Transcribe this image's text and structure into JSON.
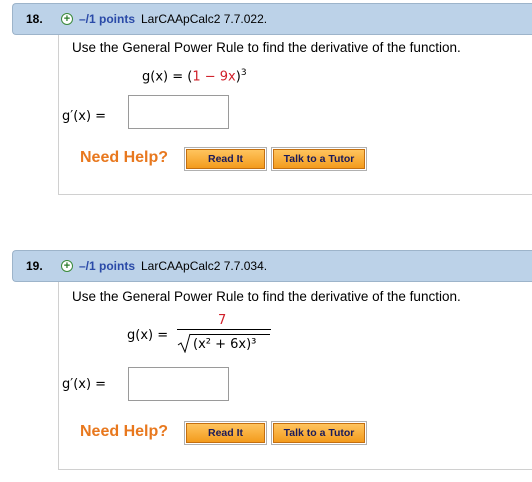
{
  "questions": [
    {
      "number": "18.",
      "points": "–/1 points",
      "id": "LarCAApCalc2 7.7.022.",
      "prompt": "Use the General Power Rule to find the derivative of the function.",
      "func_lhs": "g(x) = ",
      "func_open": "(",
      "func_red": "1 − 9x",
      "func_close": ")",
      "func_exp": "3",
      "answer_label": "g′(x) =",
      "answer_value": "",
      "need_help": "Need Help?",
      "read_it": "Read It",
      "talk_tutor": "Talk to a Tutor"
    },
    {
      "number": "19.",
      "points": "–/1 points",
      "id": "LarCAApCalc2 7.7.034.",
      "prompt": "Use the General Power Rule to find the derivative of the function.",
      "func_lhs": "g(x) =",
      "func_num": "7",
      "func_den": "(x² + 6x)³",
      "answer_label": "g′(x) =",
      "answer_value": "",
      "need_help": "Need Help?",
      "read_it": "Read It",
      "talk_tutor": "Talk to a Tutor"
    }
  ],
  "colors": {
    "header_bg": "#bcd2e8",
    "points_blue": "#2a4aa8",
    "red": "#d0202a",
    "need_help_orange": "#e8781e",
    "button_orange": "#f39b1d"
  },
  "icons": {
    "expand": "plus-circle-icon"
  }
}
